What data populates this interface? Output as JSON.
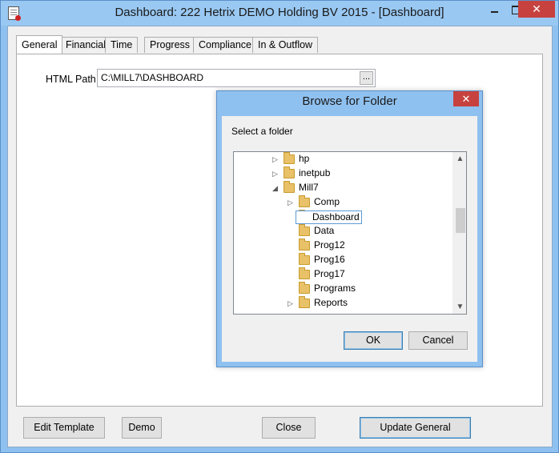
{
  "window": {
    "title": "Dashboard: 222 Hetrix DEMO Holding BV 2015 - [Dashboard]",
    "close_glyph": "✕"
  },
  "tabs": [
    {
      "label": "General",
      "active": true
    },
    {
      "label": "Financial"
    },
    {
      "label": "Time"
    },
    {
      "label": "Progress"
    },
    {
      "label": "Compliance"
    },
    {
      "label": "In & Outflow"
    }
  ],
  "general": {
    "html_path_label": "HTML Path",
    "html_path_value": "C:\\MILL7\\DASHBOARD",
    "browse_glyph": "..."
  },
  "buttons": {
    "edit_template": "Edit Template",
    "demo": "Demo",
    "close": "Close",
    "update_general": "Update General"
  },
  "dialog": {
    "title": "Browse for Folder",
    "close_glyph": "✕",
    "label": "Select a folder",
    "ok": "OK",
    "cancel": "Cancel",
    "tree": [
      {
        "name": "hp",
        "level": 0,
        "expander": "collapsed"
      },
      {
        "name": "inetpub",
        "level": 0,
        "expander": "collapsed"
      },
      {
        "name": "Mill7",
        "level": 0,
        "expander": "expanded"
      },
      {
        "name": "Comp",
        "level": 1,
        "expander": "collapsed"
      },
      {
        "name": "Dashboard",
        "level": 1,
        "expander": "none",
        "selected": true
      },
      {
        "name": "Data",
        "level": 1,
        "expander": "none"
      },
      {
        "name": "Prog12",
        "level": 1,
        "expander": "none"
      },
      {
        "name": "Prog16",
        "level": 1,
        "expander": "none"
      },
      {
        "name": "Prog17",
        "level": 1,
        "expander": "none"
      },
      {
        "name": "Programs",
        "level": 1,
        "expander": "none"
      },
      {
        "name": "Reports",
        "level": 1,
        "expander": "collapsed"
      }
    ]
  }
}
